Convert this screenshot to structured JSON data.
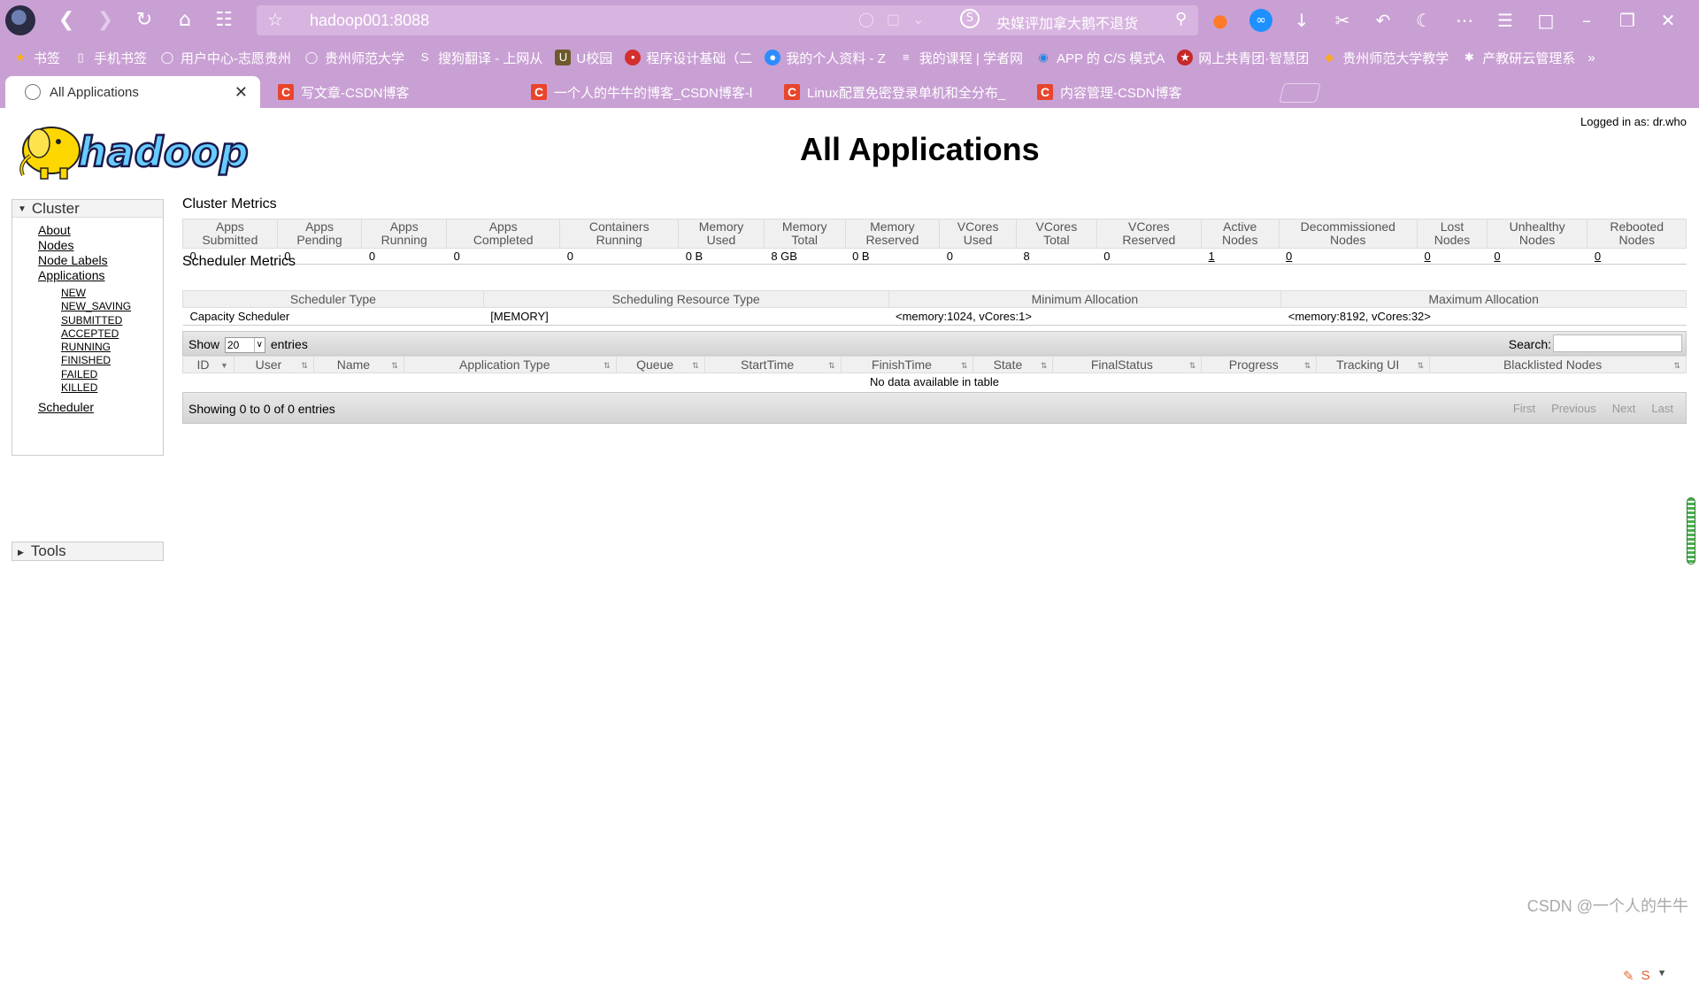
{
  "browser": {
    "address": "hadoop001:8088",
    "news_search": "央媒评加拿大鹅不退货",
    "bookmarks": [
      "书签",
      "手机书签",
      "用户中心-志愿贵州",
      "贵州师范大学",
      "搜狗翻译 - 上网从",
      "U校园",
      "程序设计基础（二",
      "我的个人资料 - Z",
      "我的课程 | 学者网",
      "APP 的 C/S 模式A",
      "网上共青团·智慧团",
      "贵州师范大学教学",
      "产教研云管理系"
    ],
    "tabs": [
      {
        "label": "All Applications",
        "active": true
      },
      {
        "label": "写文章-CSDN博客",
        "active": false
      },
      {
        "label": "一个人的牛牛的博客_CSDN博客-l",
        "active": false
      },
      {
        "label": "Linux配置免密登录单机和全分布_",
        "active": false
      },
      {
        "label": "内容管理-CSDN博客",
        "active": false
      }
    ]
  },
  "header": {
    "logged_in": "Logged in as: dr.who",
    "title": "All Applications",
    "logo_text": "hadoop"
  },
  "sidebar": {
    "cluster_label": "Cluster",
    "links": [
      "About",
      "Nodes",
      "Node Labels",
      "Applications"
    ],
    "states": [
      "NEW",
      "NEW_SAVING",
      "SUBMITTED",
      "ACCEPTED",
      "RUNNING",
      "FINISHED",
      "FAILED",
      "KILLED"
    ],
    "scheduler": "Scheduler",
    "tools_label": "Tools"
  },
  "cluster_metrics": {
    "label": "Cluster Metrics",
    "headers": [
      [
        "Apps",
        "Submitted"
      ],
      [
        "Apps",
        "Pending"
      ],
      [
        "Apps",
        "Running"
      ],
      [
        "Apps",
        "Completed"
      ],
      [
        "Containers",
        "Running"
      ],
      [
        "Memory",
        "Used"
      ],
      [
        "Memory",
        "Total"
      ],
      [
        "Memory",
        "Reserved"
      ],
      [
        "VCores",
        "Used"
      ],
      [
        "VCores",
        "Total"
      ],
      [
        "VCores",
        "Reserved"
      ],
      [
        "Active",
        "Nodes"
      ],
      [
        "Decommissioned",
        "Nodes"
      ],
      [
        "Lost",
        "Nodes"
      ],
      [
        "Unhealthy",
        "Nodes"
      ],
      [
        "Rebooted",
        "Nodes"
      ]
    ],
    "values": [
      "0",
      "0",
      "0",
      "0",
      "0",
      "0 B",
      "8 GB",
      "0 B",
      "0",
      "8",
      "0",
      "1",
      "0",
      "0",
      "0",
      "0"
    ]
  },
  "scheduler_metrics": {
    "label": "Scheduler Metrics",
    "headers": [
      "Scheduler Type",
      "Scheduling Resource Type",
      "Minimum Allocation",
      "Maximum Allocation"
    ],
    "values": [
      "Capacity Scheduler",
      "[MEMORY]",
      "<memory:1024, vCores:1>",
      "<memory:8192, vCores:32>"
    ]
  },
  "apps_table": {
    "show_label": "Show",
    "show_value": "20",
    "entries_label": "entries",
    "search_label": "Search:",
    "columns": [
      "ID",
      "User",
      "Name",
      "Application Type",
      "Queue",
      "StartTime",
      "FinishTime",
      "State",
      "FinalStatus",
      "Progress",
      "Tracking UI",
      "Blacklisted Nodes"
    ],
    "empty_message": "No data available in table",
    "info": "Showing 0 to 0 of 0 entries",
    "pager": [
      "First",
      "Previous",
      "Next",
      "Last"
    ]
  },
  "watermark": "CSDN @一个人的牛牛",
  "colors": {
    "browser_chrome": "#c9a0d4",
    "header_bg": "#f0f0f0",
    "hadoop_yellow": "#ffd700",
    "hadoop_blue": "#66ccff"
  }
}
